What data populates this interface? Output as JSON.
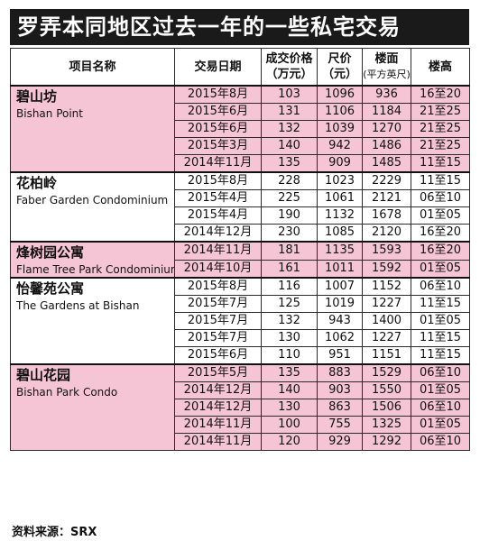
{
  "title": "罗弄本同地区过去一年的一些私宅交易",
  "headers": {
    "name": "项目名称",
    "date": "交易日期",
    "price_line1": "成交价格",
    "price_line2": "（万元）",
    "psf_line1": "尺价",
    "psf_line2": "（元）",
    "area_line1": "楼面",
    "area_line2": "(平方英尺)",
    "floor": "楼高"
  },
  "groups": [
    {
      "name_cn": "碧山坊",
      "name_en": "Bishan Point",
      "band": "pink",
      "rows": [
        {
          "date": "2015年8月",
          "price": "103",
          "psf": "1096",
          "area": "936",
          "floor": "16至20"
        },
        {
          "date": "2015年6月",
          "price": "131",
          "psf": "1106",
          "area": "1184",
          "floor": "21至25"
        },
        {
          "date": "2015年6月",
          "price": "132",
          "psf": "1039",
          "area": "1270",
          "floor": "21至25"
        },
        {
          "date": "2015年3月",
          "price": "140",
          "psf": "942",
          "area": "1486",
          "floor": "21至25"
        },
        {
          "date": "2014年11月",
          "price": "135",
          "psf": "909",
          "area": "1485",
          "floor": "11至15"
        }
      ]
    },
    {
      "name_cn": "花柏岭",
      "name_en": "Faber Garden Condominium",
      "band": "white",
      "rows": [
        {
          "date": "2015年8月",
          "price": "228",
          "psf": "1023",
          "area": "2229",
          "floor": "11至15"
        },
        {
          "date": "2015年4月",
          "price": "225",
          "psf": "1061",
          "area": "2121",
          "floor": "06至10"
        },
        {
          "date": "2015年4月",
          "price": "190",
          "psf": "1132",
          "area": "1678",
          "floor": "01至05"
        },
        {
          "date": "2014年12月",
          "price": "230",
          "psf": "1085",
          "area": "2120",
          "floor": "16至20"
        }
      ]
    },
    {
      "name_cn": "烽树园公寓",
      "name_en": "Flame Tree Park Condominium",
      "band": "pink",
      "rows": [
        {
          "date": "2014年11月",
          "price": "181",
          "psf": "1135",
          "area": "1593",
          "floor": "16至20"
        },
        {
          "date": "2014年10月",
          "price": "161",
          "psf": "1011",
          "area": "1592",
          "floor": "01至05"
        }
      ]
    },
    {
      "name_cn": "怡馨苑公寓",
      "name_en": "The Gardens at Bishan",
      "band": "white",
      "rows": [
        {
          "date": "2015年8月",
          "price": "116",
          "psf": "1007",
          "area": "1152",
          "floor": "06至10"
        },
        {
          "date": "2015年7月",
          "price": "125",
          "psf": "1019",
          "area": "1227",
          "floor": "11至15"
        },
        {
          "date": "2015年7月",
          "price": "132",
          "psf": "943",
          "area": "1400",
          "floor": "01至05"
        },
        {
          "date": "2015年7月",
          "price": "130",
          "psf": "1062",
          "area": "1227",
          "floor": "11至15"
        },
        {
          "date": "2015年6月",
          "price": "110",
          "psf": "951",
          "area": "1151",
          "floor": "11至15"
        }
      ]
    },
    {
      "name_cn": "碧山花园",
      "name_en": "Bishan Park Condo",
      "band": "pink",
      "rows": [
        {
          "date": "2015年5月",
          "price": "135",
          "psf": "883",
          "area": "1529",
          "floor": "06至10"
        },
        {
          "date": "2014年12月",
          "price": "140",
          "psf": "903",
          "area": "1550",
          "floor": "01至05"
        },
        {
          "date": "2014年12月",
          "price": "130",
          "psf": "863",
          "area": "1506",
          "floor": "06至10"
        },
        {
          "date": "2014年11月",
          "price": "100",
          "psf": "755",
          "area": "1325",
          "floor": "01至05"
        },
        {
          "date": "2014年11月",
          "price": "120",
          "psf": "929",
          "area": "1292",
          "floor": "06至10"
        }
      ]
    }
  ],
  "source": "资料来源：SRX",
  "colors": {
    "pink_band": "#f6c5d5",
    "title_bg": "#1a1a1a"
  }
}
